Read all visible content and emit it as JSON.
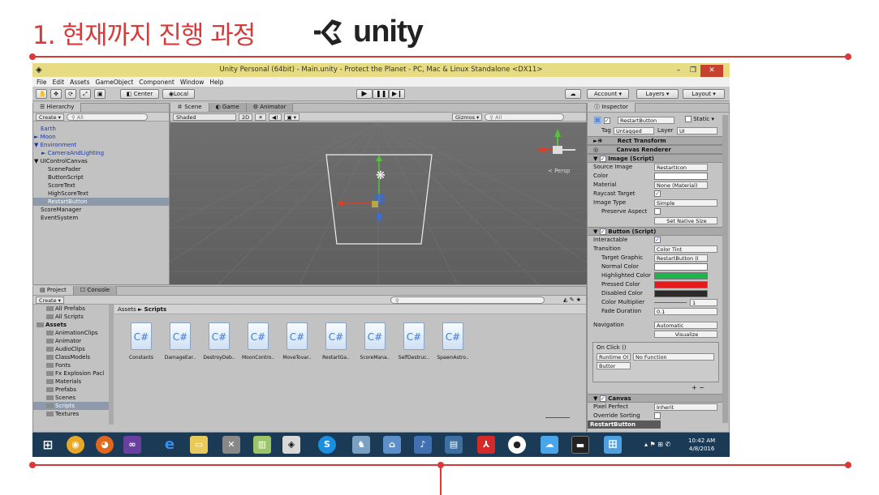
{
  "slide": {
    "title": "1. 현재까지 진행 과정",
    "logo_text": "unity",
    "accent_color": "#d83a3a"
  },
  "window": {
    "title": "Unity Personal (64bit) - Main.unity - Protect the Planet - PC, Mac & Linux Standalone <DX11>",
    "title_bar_color": "#e7dc84",
    "controls": [
      "minimize-icon",
      "restore-icon",
      "close-icon"
    ]
  },
  "menu": [
    "File",
    "Edit",
    "Assets",
    "GameObject",
    "Component",
    "Window",
    "Help"
  ],
  "toolbar": {
    "center_label": "Center",
    "local_label": "Local",
    "account_label": "Account",
    "layers_label": "Layers",
    "layout_label": "Layout"
  },
  "hierarchy": {
    "tab_label": "Hierarchy",
    "create_label": "Create",
    "search_placeholder": "All",
    "items": [
      {
        "label": "Earth",
        "indent": 0,
        "arrow": "",
        "color": "blue"
      },
      {
        "label": "Moon",
        "indent": 0,
        "arrow": "►",
        "color": "blue"
      },
      {
        "label": "Environment",
        "indent": 0,
        "arrow": "▼",
        "color": "blue"
      },
      {
        "label": "CameraAndLighting",
        "indent": 1,
        "arrow": "►",
        "color": "blue"
      },
      {
        "label": "UIControlCanvas",
        "indent": 0,
        "arrow": "▼",
        "color": "black"
      },
      {
        "label": "SceneFader",
        "indent": 1,
        "arrow": "",
        "color": "black"
      },
      {
        "label": "ButtonScript",
        "indent": 1,
        "arrow": "",
        "color": "black"
      },
      {
        "label": "ScoreText",
        "indent": 1,
        "arrow": "",
        "color": "black"
      },
      {
        "label": "HighScoreText",
        "indent": 1,
        "arrow": "",
        "color": "black"
      },
      {
        "label": "RestartButton",
        "indent": 1,
        "arrow": "",
        "color": "black",
        "selected": true
      },
      {
        "label": "ScoreManager",
        "indent": 0,
        "arrow": "",
        "color": "black"
      },
      {
        "label": "EventSystem",
        "indent": 0,
        "arrow": "",
        "color": "black"
      }
    ]
  },
  "scene": {
    "tabs": [
      "Scene",
      "Game",
      "Animator"
    ],
    "shading": "Shaded",
    "mode_2d": "2D",
    "gizmos_label": "Gizmos",
    "search_placeholder": "All",
    "persp_label": "< Persp"
  },
  "inspector": {
    "tab_label": "Inspector",
    "object_name": "RestartButton",
    "static_label": "Static",
    "tag_label": "Tag",
    "tag_value": "Untagged",
    "layer_label": "Layer",
    "layer_value": "UI",
    "components": {
      "rect_transform": "Rect Transform",
      "canvas_renderer": "Canvas Renderer",
      "image": "Image (Script)",
      "button": "Button (Script)",
      "canvas": "Canvas"
    },
    "image_fields": {
      "source_image_label": "Source Image",
      "source_image_value": "RestartIcon",
      "color_label": "Color",
      "material_label": "Material",
      "material_value": "None (Material)",
      "raycast_label": "Raycast Target",
      "image_type_label": "Image Type",
      "image_type_value": "Simple",
      "preserve_label": "Preserve Aspect",
      "set_native_label": "Set Native Size"
    },
    "button_fields": {
      "interactable_label": "Interactable",
      "transition_label": "Transition",
      "transition_value": "Color Tint",
      "target_graphic_label": "Target Graphic",
      "target_graphic_value": "RestartButton (I",
      "normal_label": "Normal Color",
      "highlighted_label": "Highlighted Color",
      "pressed_label": "Pressed Color",
      "disabled_label": "Disabled Color",
      "multiplier_label": "Color Multiplier",
      "multiplier_value": "1",
      "fade_label": "Fade Duration",
      "fade_value": "0.1",
      "navigation_label": "Navigation",
      "navigation_value": "Automatic",
      "visualize_label": "Visualize",
      "onclick_label": "On Click ()",
      "runtime_value": "Runtime Ol",
      "function_value": "No Function",
      "object_value": "Buttor"
    },
    "canvas_fields": {
      "pixel_perfect_label": "Pixel Perfect",
      "pixel_perfect_value": "Inherit",
      "override_label": "Override Sorting"
    },
    "footer_label": "RestartButton",
    "colors": {
      "normal": "#ffffff",
      "highlighted": "#1fb34b",
      "pressed": "#e31b1b",
      "disabled": "#2a2a2a"
    }
  },
  "project": {
    "tabs": [
      "Project",
      "Console"
    ],
    "create_label": "Create",
    "breadcrumb_root": "Assets",
    "breadcrumb_leaf": "Scripts",
    "tree": [
      {
        "label": "All Prefabs",
        "level": 1
      },
      {
        "label": "All Scripts",
        "level": 1
      },
      {
        "label": "Assets",
        "level": 0,
        "bold": true
      },
      {
        "label": "AnimationClips",
        "level": 1
      },
      {
        "label": "Animator",
        "level": 1
      },
      {
        "label": "AudioClips",
        "level": 1
      },
      {
        "label": "ClassModels",
        "level": 1
      },
      {
        "label": "Fonts",
        "level": 1
      },
      {
        "label": "Fx Explosion Pacl",
        "level": 1
      },
      {
        "label": "Materials",
        "level": 1
      },
      {
        "label": "Prefabs",
        "level": 1
      },
      {
        "label": "Scenes",
        "level": 1
      },
      {
        "label": "Scripts",
        "level": 1,
        "selected": true
      },
      {
        "label": "Textures",
        "level": 1
      }
    ],
    "assets": [
      "Constants",
      "DamageEar..",
      "DestroyDeb..",
      "MoonContro..",
      "MoveTovar..",
      "RestartGa..",
      "ScoreMana..",
      "SelfDestruc..",
      "SpawnAstro.."
    ]
  },
  "taskbar": {
    "time": "10:42 AM",
    "date": "4/8/2016",
    "icons": [
      "windows-start-icon",
      "chrome-icon",
      "firefox-icon",
      "visual-studio-icon",
      "ie-icon",
      "file-explorer-icon",
      "tools-icon",
      "chart-app-icon",
      "unity-icon",
      "skype-icon",
      "game-icon",
      "network-icon",
      "media-icon",
      "library-icon",
      "acrobat-icon",
      "github-icon",
      "cloud-icon",
      "terminal-icon",
      "app-icon"
    ]
  }
}
